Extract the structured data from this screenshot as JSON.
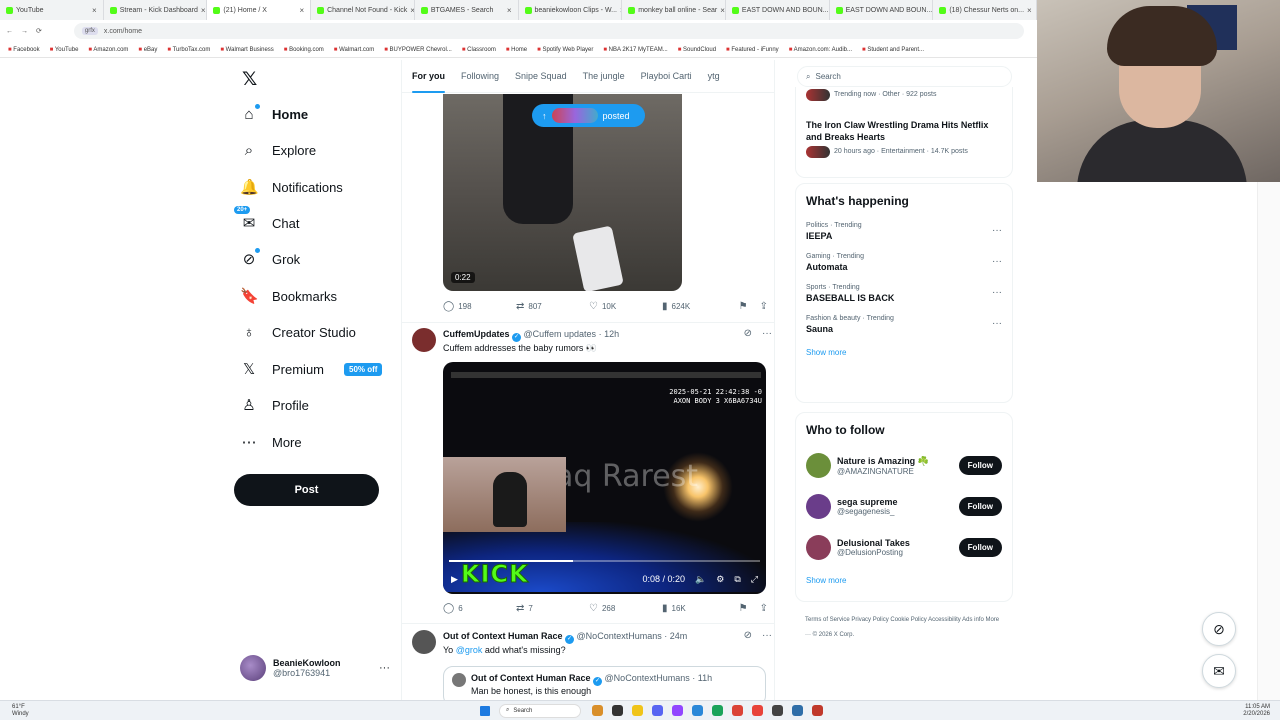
{
  "browser": {
    "tabs": [
      {
        "label": "YouTube",
        "active": false
      },
      {
        "label": "Stream - Kick Dashboard",
        "active": false
      },
      {
        "label": "(21) Home / X",
        "active": true
      },
      {
        "label": "Channel Not Found - Kick",
        "active": false
      },
      {
        "label": "BTGAMES - Search",
        "active": false
      },
      {
        "label": "beaniekowloon Clips - W...",
        "active": false
      },
      {
        "label": "monkey ball online - Sear",
        "active": false
      },
      {
        "label": "EAST DOWN AND BOUN...",
        "active": false
      },
      {
        "label": "EAST DOWN AND BOUN...",
        "active": false
      },
      {
        "label": "(18) Chessur Nerts on...",
        "active": false
      }
    ],
    "url": "x.com/home",
    "bookmarks": [
      "Facebook",
      "YouTube",
      "Amazon.com",
      "eBay",
      "TurboTax.com",
      "Walmart Business",
      "Booking.com",
      "Walmart.com",
      "BUYPOWER Chevrol...",
      "Classroom",
      "Home",
      "Spotify Web Player",
      "NBA 2K17 MyTEAM...",
      "SoundCloud",
      "Featured - iFunny",
      "Amazon.com: Audib...",
      "Student and Parent..."
    ]
  },
  "nav": {
    "items": [
      {
        "label": "Home",
        "icon": "home-icon",
        "glyph": "⌂"
      },
      {
        "label": "Explore",
        "icon": "search-icon",
        "glyph": "⌕"
      },
      {
        "label": "Notifications",
        "icon": "bell-icon",
        "glyph": "🔔"
      },
      {
        "label": "Chat",
        "icon": "chat-icon",
        "glyph": "✉"
      },
      {
        "label": "Grok",
        "icon": "grok-icon",
        "glyph": "⊘"
      },
      {
        "label": "Bookmarks",
        "icon": "bookmark-icon",
        "glyph": "🔖"
      },
      {
        "label": "Creator Studio",
        "icon": "creator-icon",
        "glyph": "♁"
      },
      {
        "label": "Premium",
        "icon": "x-premium-icon",
        "glyph": "𝕏"
      },
      {
        "label": "Profile",
        "icon": "person-icon",
        "glyph": "♙"
      },
      {
        "label": "More",
        "icon": "more-circle-icon",
        "glyph": "⋯"
      }
    ],
    "premium_badge": "50% off",
    "chat_badge": "20+",
    "post_label": "Post",
    "account": {
      "name": "BeanieKowloon",
      "handle": "@bro1763941"
    }
  },
  "feed": {
    "tabs": [
      "For you",
      "Following",
      "Snipe Squad",
      "The jungle",
      "Playboi Carti",
      "ytg"
    ],
    "posted_label": "posted",
    "tweet1": {
      "duration": "0:22",
      "stats": {
        "replies": "198",
        "reposts": "807",
        "likes": "10K",
        "views": "624K"
      }
    },
    "tweet2": {
      "name": "CuffemUpdates",
      "handle": "@Cuffem updates",
      "time": "· 12h",
      "text": "Cuffem addresses the baby rumors 👀",
      "video_timestamp": "2025-05-21 22:42:38 -0\nAXON BODY 3 X6BA6734U",
      "watermark": "aq Rarest",
      "logo": "KICK",
      "time_display": "0:08 / 0:20",
      "progress_pct": 40,
      "stats": {
        "replies": "6",
        "reposts": "7",
        "likes": "268",
        "views": "16K"
      }
    },
    "tweet3": {
      "name": "Out of Context Human Race",
      "handle": "@NoContextHumans",
      "time": "· 24m",
      "text_prefix": "Yo ",
      "mention": "@grok",
      "text_suffix": " add what's missing?",
      "quote_name": "Out of Context Human Race",
      "quote_handle": "@NoContextHumans",
      "quote_time": "· 11h",
      "quote_text": "Man be honest, is this enough"
    }
  },
  "right": {
    "search_placeholder": "Search",
    "news_top": {
      "meta": "Trending now · Other · 922 posts"
    },
    "news": {
      "title": "The Iron Claw Wrestling Drama Hits Netflix and Breaks Hearts",
      "meta": "20 hours ago · Entertainment · 14.7K posts"
    },
    "happening_title": "What's happening",
    "trends": [
      {
        "context": "Politics · Trending",
        "title": "IEEPA"
      },
      {
        "context": "Gaming · Trending",
        "title": "Automata"
      },
      {
        "context": "Sports · Trending",
        "title": "BASEBALL IS BACK"
      },
      {
        "context": "Fashion & beauty · Trending",
        "title": "Sauna"
      }
    ],
    "show_more": "Show more",
    "wtf_title": "Who to follow",
    "follow_label": "Follow",
    "who_to_follow": [
      {
        "name": "Nature is Amazing ☘️",
        "handle": "@AMAZINGNATURE",
        "color": "#6b8f3a"
      },
      {
        "name": "sega supreme",
        "handle": "@segagenesis_",
        "color": "#6a3d8a"
      },
      {
        "name": "Delusional Takes",
        "handle": "@DelusionPosting",
        "color": "#8a3d5a"
      }
    ],
    "footer": [
      "Terms of Service",
      "Privacy Policy",
      "Cookie Policy",
      "Accessibility",
      "Ads info",
      "More ···",
      "© 2026 X Corp."
    ]
  },
  "taskbar": {
    "weather": "61°F\nWindy",
    "search": "Search",
    "time": "11:05 AM",
    "date": "2/20/2026"
  },
  "colors": {
    "accent": "#1d9bf0",
    "kick_green": "#53fc18",
    "text": "#0f1419",
    "muted": "#536471"
  }
}
